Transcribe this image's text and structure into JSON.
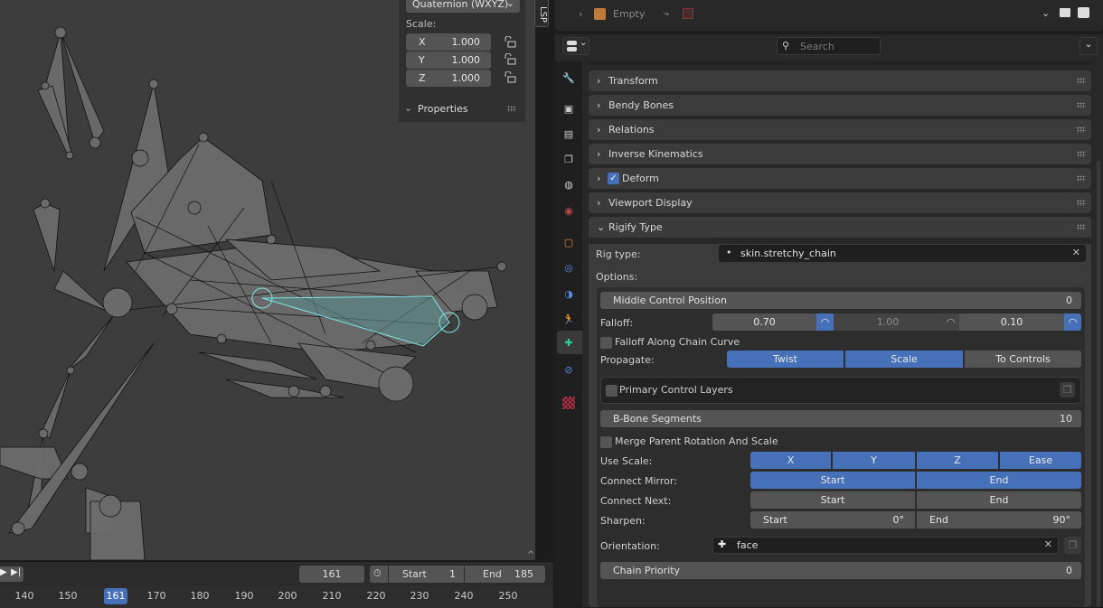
{
  "viewport": {
    "rotation_mode": "Quaternion (WXYZ)",
    "scale_label": "Scale:",
    "scale": [
      {
        "axis": "X",
        "value": "1.000"
      },
      {
        "axis": "Y",
        "value": "1.000"
      },
      {
        "axis": "Z",
        "value": "1.000"
      }
    ],
    "properties_label": "Properties",
    "sidebar_tab": "LSP"
  },
  "timeline": {
    "current_frame": "161",
    "start_label": "Start",
    "start": "1",
    "end_label": "End",
    "end": "185",
    "ruler": [
      "140",
      "150",
      "161",
      "170",
      "180",
      "190",
      "200",
      "210",
      "220",
      "230",
      "240",
      "250"
    ]
  },
  "outliner": {
    "item_label": "Empty"
  },
  "properties": {
    "search_placeholder": "Search",
    "panels": [
      {
        "label": "Transform",
        "expanded": false
      },
      {
        "label": "Bendy Bones",
        "expanded": false
      },
      {
        "label": "Relations",
        "expanded": false
      },
      {
        "label": "Inverse Kinematics",
        "expanded": false
      },
      {
        "label": "Deform",
        "expanded": false,
        "checked": true
      },
      {
        "label": "Viewport Display",
        "expanded": false
      },
      {
        "label": "Rigify Type",
        "expanded": true
      }
    ],
    "rigify": {
      "rig_type_label": "Rig type:",
      "rig_type": "skin.stretchy_chain",
      "options_label": "Options:",
      "middle_control_label": "Middle Control Position",
      "middle_control_value": "0",
      "falloff_label": "Falloff:",
      "falloff": [
        "0.70",
        "1.00",
        "0.10"
      ],
      "falloff_along_curve": "Falloff Along Chain Curve",
      "propagate_label": "Propagate:",
      "propagate": [
        {
          "label": "Twist",
          "on": true
        },
        {
          "label": "Scale",
          "on": true
        },
        {
          "label": "To Controls",
          "on": false
        }
      ],
      "primary_layers": "Primary Control Layers",
      "bbone_label": "B-Bone Segments",
      "bbone_value": "10",
      "merge_parent": "Merge Parent Rotation And Scale",
      "use_scale_label": "Use Scale:",
      "use_scale": [
        {
          "label": "X",
          "on": true
        },
        {
          "label": "Y",
          "on": true
        },
        {
          "label": "Z",
          "on": true
        },
        {
          "label": "Ease",
          "on": true
        }
      ],
      "connect_mirror_label": "Connect Mirror:",
      "connect_mirror": [
        {
          "label": "Start",
          "on": true
        },
        {
          "label": "End",
          "on": true
        }
      ],
      "connect_next_label": "Connect Next:",
      "connect_next": [
        {
          "label": "Start",
          "on": false
        },
        {
          "label": "End",
          "on": false
        }
      ],
      "sharpen_label": "Sharpen:",
      "sharpen": [
        {
          "label": "Start",
          "value": "0°"
        },
        {
          "label": "End",
          "value": "90°"
        }
      ],
      "orientation_label": "Orientation:",
      "orientation": "face",
      "chain_priority_label": "Chain Priority",
      "chain_priority_value": "0"
    }
  },
  "colors": {
    "accent": "#4671b8",
    "selected_bone": "#7fe6e6"
  }
}
